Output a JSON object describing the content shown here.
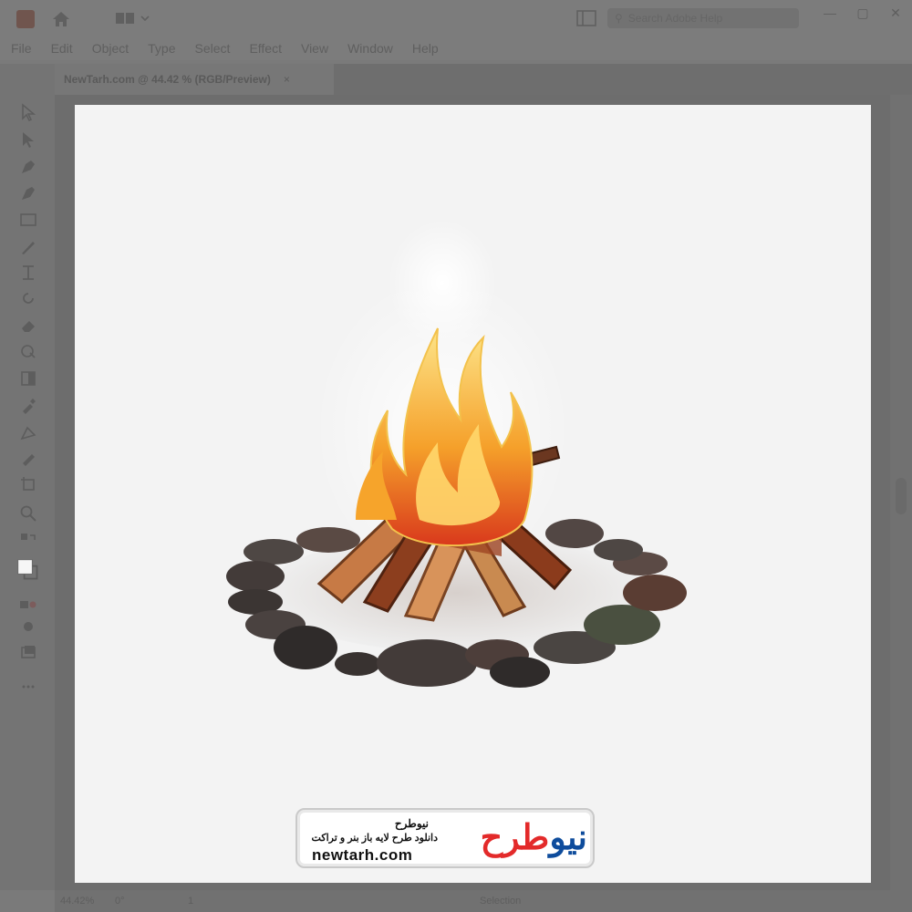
{
  "menu": [
    "File",
    "Edit",
    "Object",
    "Type",
    "Select",
    "Effect",
    "View",
    "Window",
    "Help"
  ],
  "search": {
    "placeholder": "Search Adobe Help"
  },
  "document_tab": {
    "title": "NewTarh.com @ 44.42 % (RGB/Preview)",
    "close": "×"
  },
  "window_controls": {
    "minimize": "—",
    "maximize": "▢",
    "close": "✕"
  },
  "status": {
    "zoom": "44.42%",
    "angle": "0°",
    "page": "1",
    "mode": "Selection"
  },
  "watermark": {
    "brand_fa": "نیوطرح",
    "tagline_fa": "دانلود طرح لایه باز بنر و تراکت",
    "url": "newtarh.com",
    "logo_part1": "نیو",
    "logo_part2": "طرح"
  },
  "colors": {
    "brand_blue": "#0e4c9c",
    "brand_red": "#e32a2a",
    "flame": "#f7a12a"
  }
}
